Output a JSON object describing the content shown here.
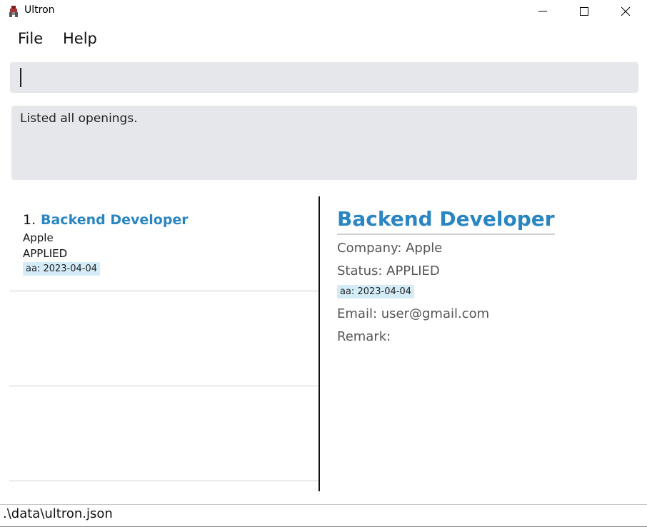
{
  "window": {
    "title": "Ultron",
    "icons": {
      "app": "app-icon",
      "minimize": "minimize-icon",
      "maximize": "maximize-icon",
      "close": "close-icon"
    }
  },
  "menu": {
    "file": "File",
    "help": "Help"
  },
  "command_box": {
    "value": "",
    "placeholder": ""
  },
  "result_display": {
    "text": "Listed all openings."
  },
  "list": {
    "items": [
      {
        "index": "1.",
        "title": "Backend Developer",
        "company": "Apple",
        "status": "APPLIED",
        "tag": "aa: 2023-04-04"
      }
    ]
  },
  "detail": {
    "title": "Backend Developer",
    "company": "Company: Apple",
    "status": "Status: APPLIED",
    "tag": "aa: 2023-04-04",
    "email": "Email: user@gmail.com",
    "remark": "Remark:"
  },
  "status_bar": {
    "path": ".\\data\\ultron.json"
  },
  "colors": {
    "accent": "#2a86c2",
    "tag_bg": "#d4ecf8",
    "box_bg": "#e5e7ea"
  }
}
